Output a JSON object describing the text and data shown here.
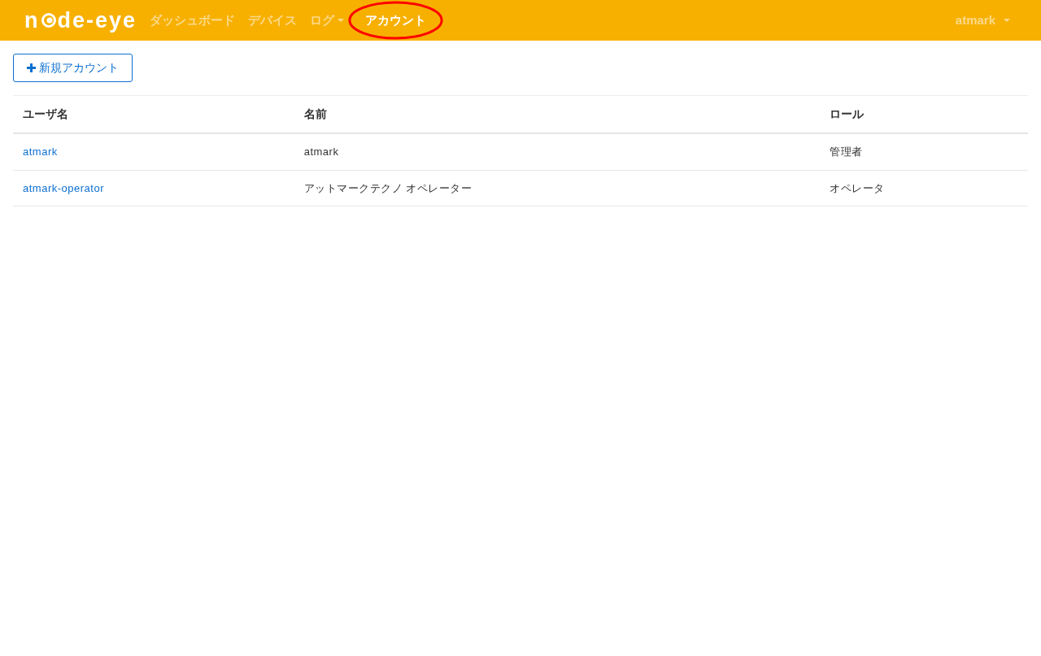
{
  "navbar": {
    "brand": {
      "text_before_icon": "n",
      "text_after_icon": "de-eye"
    },
    "items": [
      {
        "label": "ダッシュボード",
        "selected": false,
        "dropdown": false,
        "circled": false
      },
      {
        "label": "デバイス",
        "selected": false,
        "dropdown": false,
        "circled": false
      },
      {
        "label": "ログ",
        "selected": false,
        "dropdown": true,
        "circled": false
      },
      {
        "label": "アカウント",
        "selected": true,
        "dropdown": false,
        "circled": true
      }
    ],
    "user_menu": {
      "label": "atmark"
    }
  },
  "new_account_button": {
    "label": "新規アカウント"
  },
  "table": {
    "columns": [
      "ユーザ名",
      "名前",
      "ロール"
    ],
    "rows": [
      [
        "atmark",
        "atmark",
        "管理者"
      ],
      [
        "atmark-operator",
        "アットマークテクノ オペレーター",
        "オペレータ"
      ]
    ]
  }
}
